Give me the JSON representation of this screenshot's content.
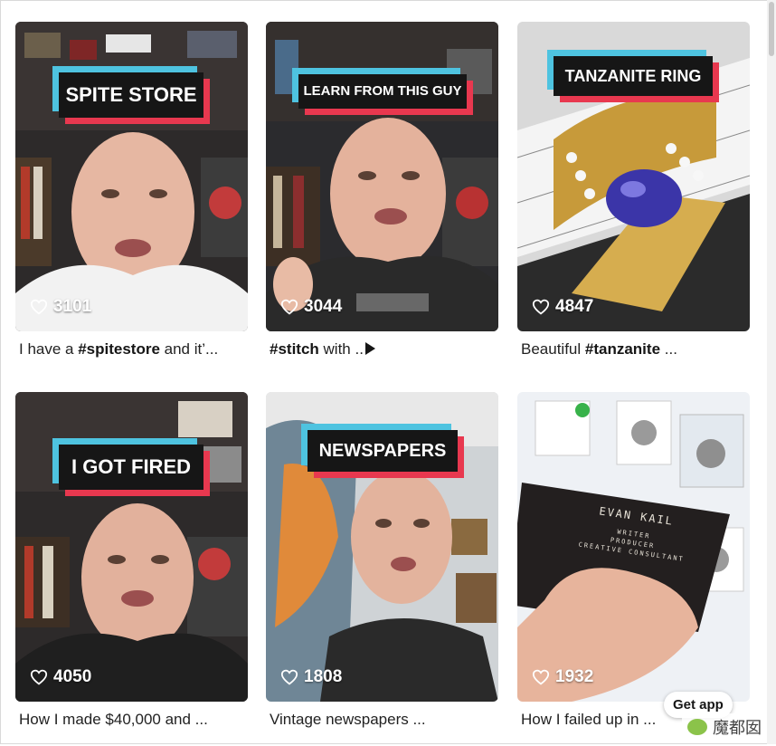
{
  "videos": [
    {
      "overlay": "SPITE STORE",
      "likes": "3101",
      "caption_pre": "I have a ",
      "caption_tag": "#spitestore",
      "caption_post": " and it’..."
    },
    {
      "overlay": "LEARN FROM THIS GUY",
      "likes": "3044",
      "caption_pre": "",
      "caption_tag": "#stitch",
      "caption_post": " with .."
    },
    {
      "overlay": "TANZANITE RING",
      "likes": "4847",
      "caption_pre": "Beautiful ",
      "caption_tag": "#tanzanite",
      "caption_post": " ..."
    },
    {
      "overlay": "I GOT FIRED",
      "likes": "4050",
      "caption_pre": "How I made $40,000 and ...",
      "caption_tag": "",
      "caption_post": ""
    },
    {
      "overlay": "NEWSPAPERS",
      "likes": "1808",
      "caption_pre": "Vintage newspapers ...",
      "caption_tag": "",
      "caption_post": ""
    },
    {
      "overlay": "",
      "likes": "1932",
      "caption_pre": "How I failed up in ...",
      "caption_tag": "",
      "caption_post": ""
    }
  ],
  "business_card": {
    "name": "EVAN KAIL",
    "line1": "WRITER",
    "line2": "PRODUCER",
    "line3": "CREATIVE CONSULTANT"
  },
  "get_app_label": "Get app",
  "watermark": "魔都囡",
  "icons": {
    "like": "heart-outline-icon",
    "play": "play-icon",
    "wechat": "wechat-bubble-icon"
  },
  "colors": {
    "overlay_bg": "#161616",
    "overlay_cyan": "#4ec3e0",
    "overlay_red": "#e8384f"
  }
}
